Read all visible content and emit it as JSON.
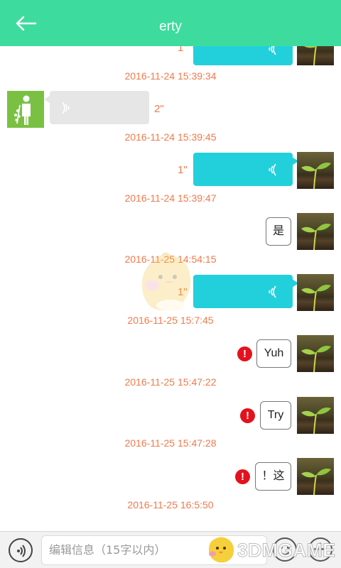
{
  "header": {
    "title": "erty",
    "back_icon": "arrow-left-icon",
    "bg_color": "#3ddc9e"
  },
  "messages": [
    {
      "type": "voice",
      "side": "out",
      "duration": "1\"",
      "partial": true
    },
    {
      "type": "time",
      "text": "2016-11-24 15:39:34"
    },
    {
      "type": "voice",
      "side": "in",
      "duration": "2\""
    },
    {
      "type": "time",
      "text": "2016-11-24 15:39:45"
    },
    {
      "type": "voice",
      "side": "out",
      "duration": "1\""
    },
    {
      "type": "time",
      "text": "2016-11-24 15:39:47"
    },
    {
      "type": "text",
      "side": "out",
      "text": "是",
      "failed": false
    },
    {
      "type": "time",
      "text": "2016-11-25 14:54:15"
    },
    {
      "type": "voice",
      "side": "out",
      "duration": "1\""
    },
    {
      "type": "time",
      "text": "2016-11-25 15:7:45"
    },
    {
      "type": "text",
      "side": "out",
      "text": "Yuh",
      "failed": true
    },
    {
      "type": "time",
      "text": "2016-11-25 15:47:22"
    },
    {
      "type": "text",
      "side": "out",
      "text": "Try",
      "failed": true
    },
    {
      "type": "time",
      "text": "2016-11-25 15:47:28"
    },
    {
      "type": "text",
      "side": "out",
      "text": "！这",
      "failed": true
    },
    {
      "type": "time",
      "text": "2016-11-25 16:5:50"
    }
  ],
  "error_mark": "!",
  "input": {
    "placeholder": "编辑信息（15字以内）"
  },
  "plus_label": "+",
  "watermark": "3DMGAME",
  "colors": {
    "outgoing_voice": "#22d0dc",
    "incoming_voice": "#e6e6e6",
    "timestamp": "#f07a4c",
    "error": "#e3121d"
  }
}
